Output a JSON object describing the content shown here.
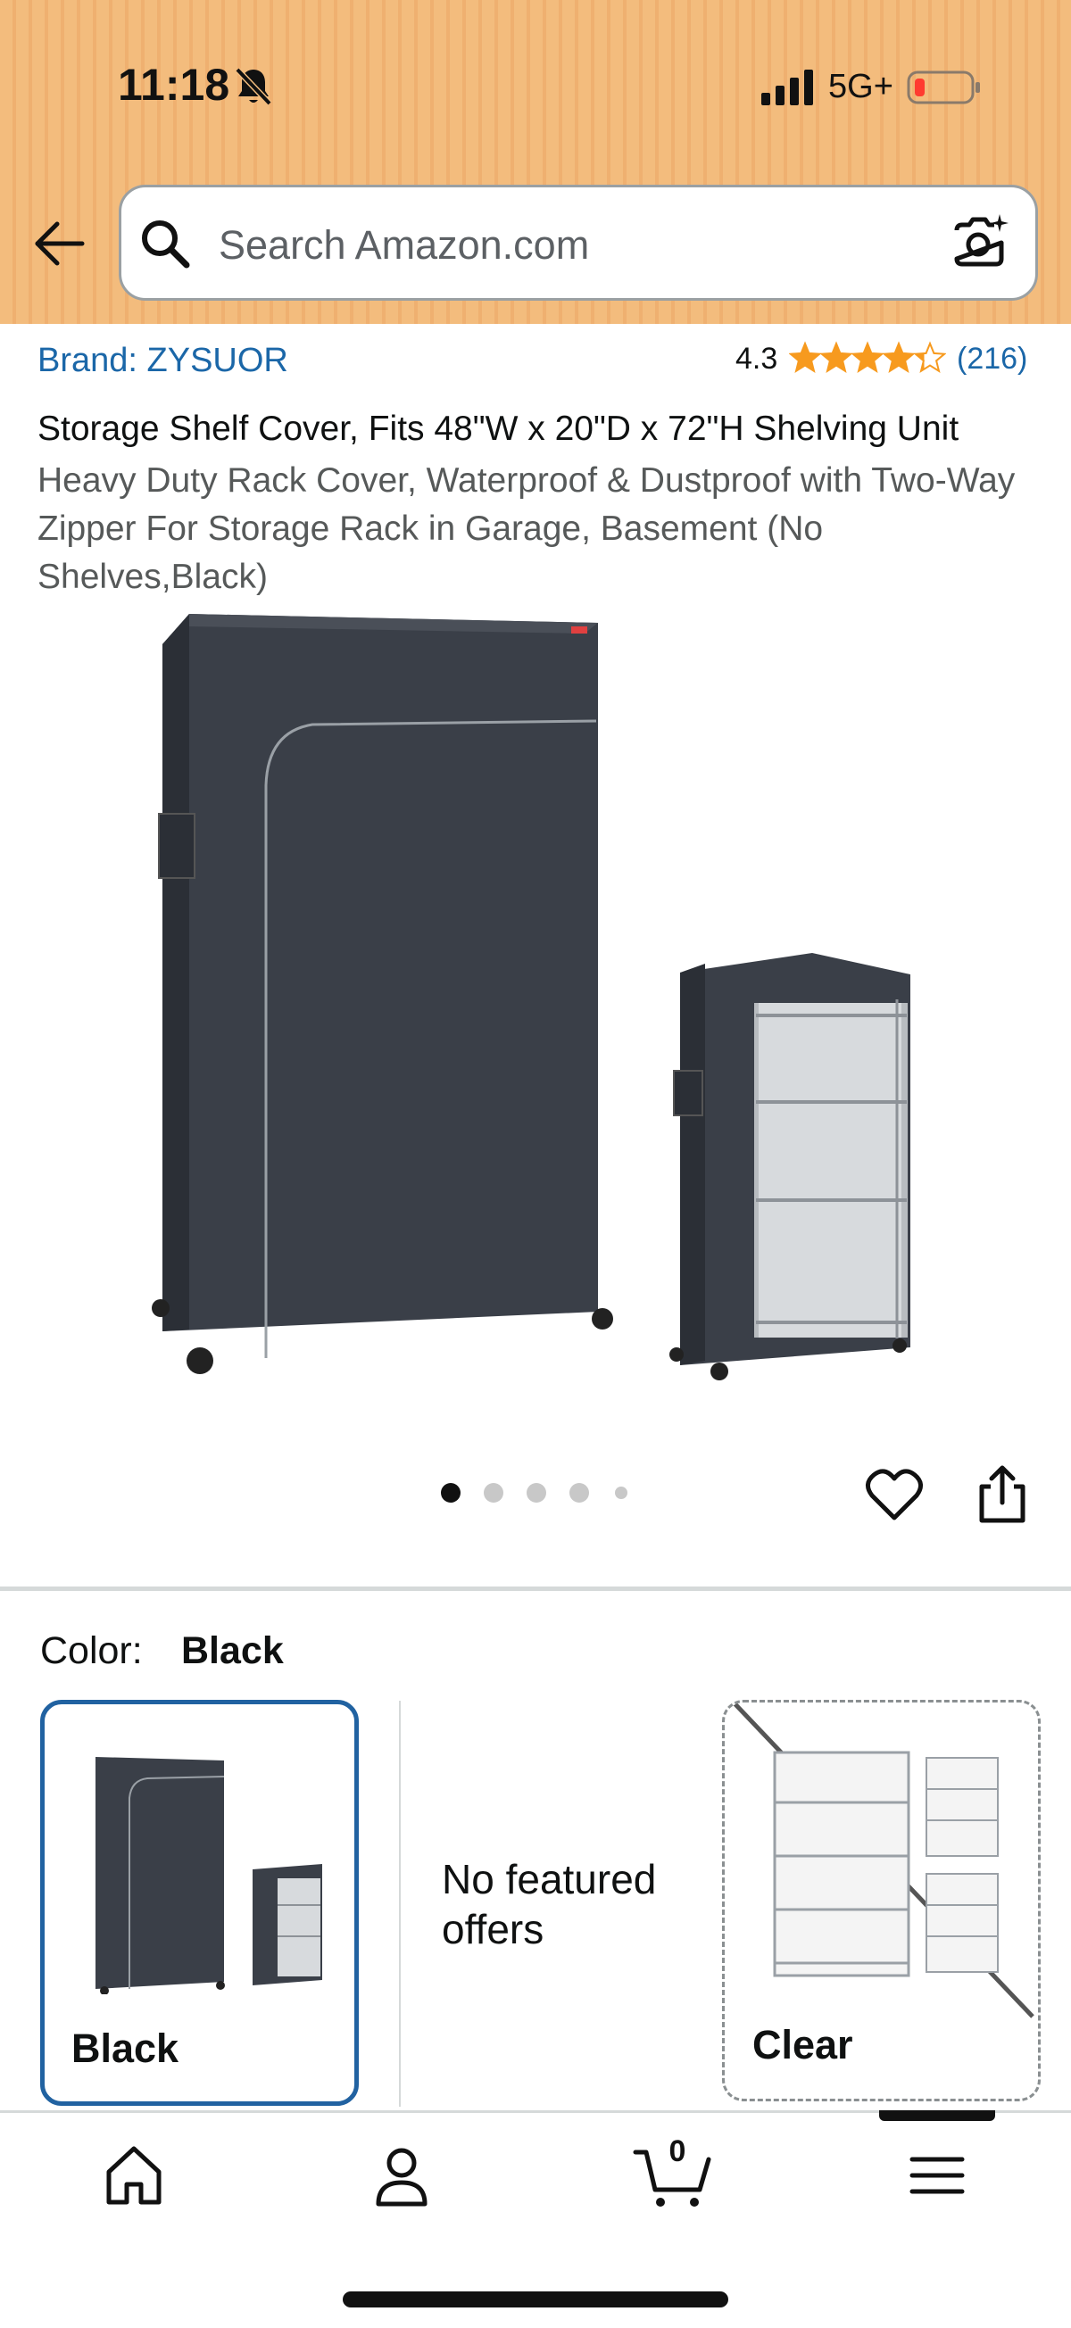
{
  "status_bar": {
    "time": "11:18",
    "network": "5G+",
    "icons": [
      "bell-slash-icon",
      "signal-icon",
      "battery-low-icon"
    ]
  },
  "search": {
    "placeholder": "Search Amazon.com"
  },
  "product": {
    "brand": "Brand: ZYSUOR",
    "rating": "4.3",
    "stars_value": 4.3,
    "review_count": "(216)",
    "title_main": "Storage Shelf Cover, Fits 48\"W x 20\"D x 72\"H Shelving Unit",
    "title_sub": "Heavy Duty Rack Cover, Waterproof & Dustproof with Two-Way Zipper For Storage Rack in Garage, Basement (No Shelves,Black)",
    "image_count": 5,
    "active_image": 1
  },
  "color_selector": {
    "label": "Color:",
    "selected": "Black",
    "options": [
      {
        "label": "Black",
        "selected": true
      },
      {
        "label": "No featured offers"
      },
      {
        "label": "Clear",
        "unavailable": true
      }
    ]
  },
  "colors": {
    "header_bg": "#f3bc7d",
    "link_blue": "#1b67a8",
    "star_orange": "#f79a1e",
    "selected_border": "#2162a1"
  },
  "bottom_nav": {
    "items": [
      "home-icon",
      "account-icon",
      "cart-icon",
      "menu-icon"
    ],
    "cart_count": "0"
  }
}
